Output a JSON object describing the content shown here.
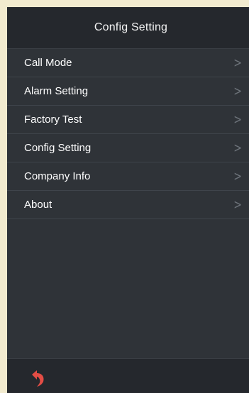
{
  "header": {
    "title": "Config Setting"
  },
  "menu": {
    "items": [
      {
        "label": "Call Mode",
        "chevron": ">"
      },
      {
        "label": "Alarm Setting",
        "chevron": ">"
      },
      {
        "label": "Factory Test",
        "chevron": ">"
      },
      {
        "label": "Config Setting",
        "chevron": ">"
      },
      {
        "label": "Company Info",
        "chevron": ">"
      },
      {
        "label": "About",
        "chevron": ">"
      }
    ]
  },
  "footer": {
    "back_icon": "return-arrow-icon"
  },
  "colors": {
    "screen_background": "#2f3338",
    "header_background": "#25282d",
    "text": "#ffffff",
    "chevron": "#6d737a",
    "back_arrow": "#e34d45"
  }
}
